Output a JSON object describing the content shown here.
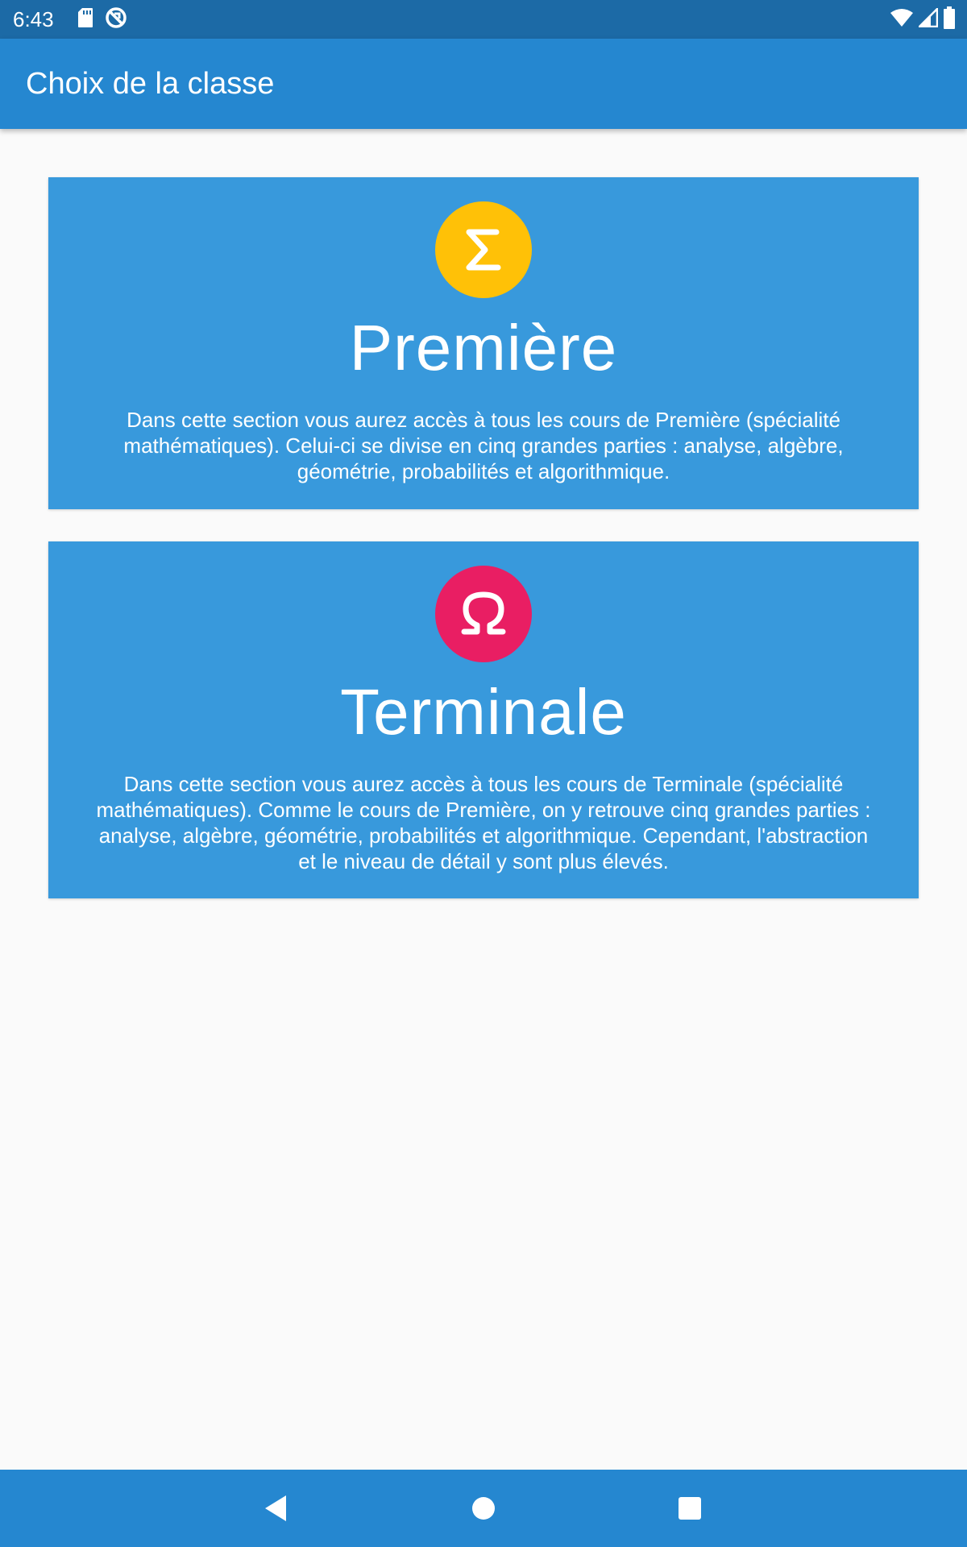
{
  "status_bar": {
    "time": "6:43"
  },
  "app_bar": {
    "title": "Choix de la classe"
  },
  "cards": [
    {
      "icon": "sigma-icon",
      "icon_color": "#ffc107",
      "title": "Première",
      "description": "Dans cette section vous aurez accès à tous les cours de Première (spécialité mathématiques). Celui-ci se divise en cinq grandes parties : analyse, algèbre, géométrie, probabilités et algorithmique."
    },
    {
      "icon": "omega-icon",
      "icon_color": "#e91e63",
      "title": "Terminale",
      "description": "Dans cette section vous aurez accès à tous les cours de Terminale (spécialité mathématiques). Comme le cours de Première, on y retrouve cinq grandes parties : analyse, algèbre, géométrie, probabilités et algorithmique. Cependant, l'abstraction et le niveau de détail y sont plus élevés."
    }
  ],
  "colors": {
    "status_bar": "#1c6aa6",
    "app_bar": "#2587d0",
    "card": "#3899dc",
    "background": "#fafafa"
  },
  "nav_bar": {
    "icons": [
      "back-icon",
      "home-icon",
      "recents-icon"
    ]
  }
}
